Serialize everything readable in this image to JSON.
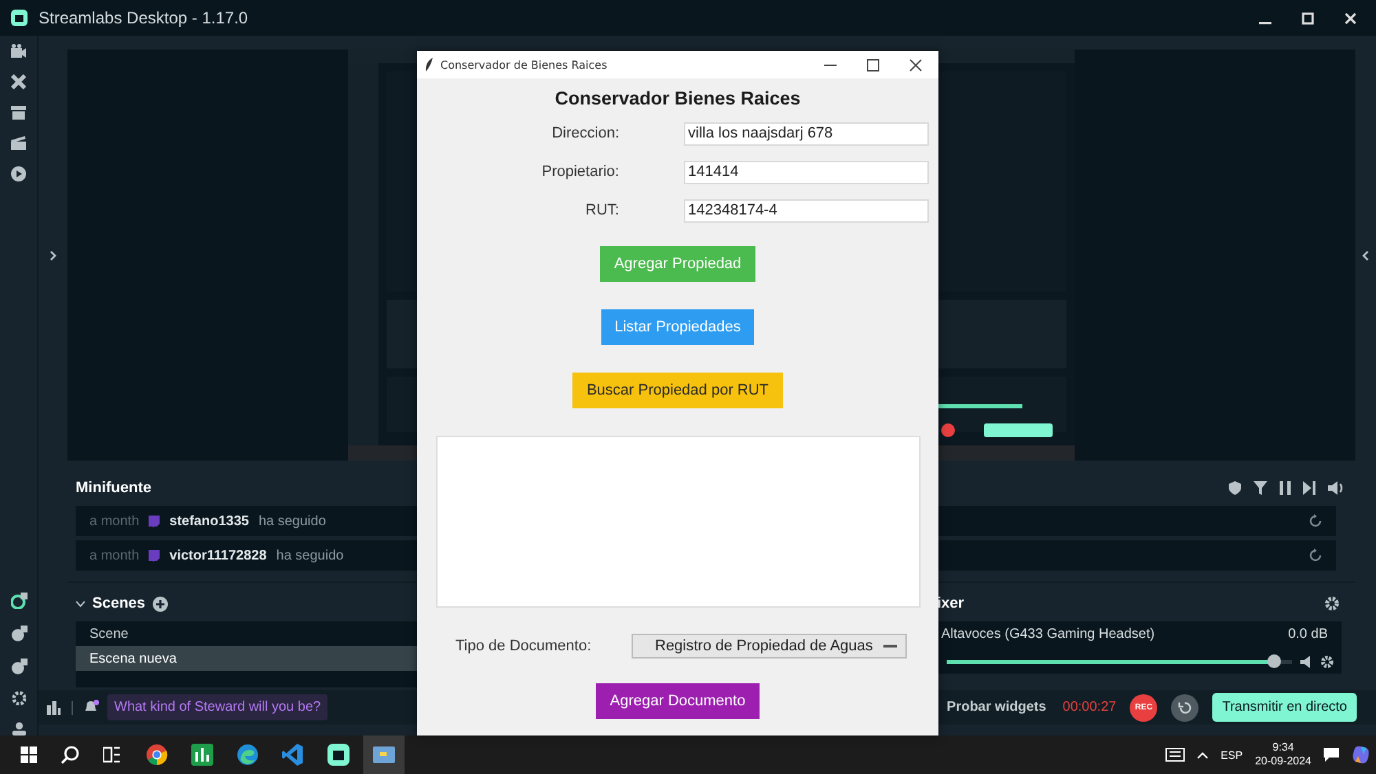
{
  "app": {
    "title": "Streamlabs Desktop - 1.17.0"
  },
  "minifeed": {
    "title": "Minifuente",
    "events": [
      {
        "time": "a month",
        "user": "stefano1335",
        "action": "ha seguido"
      },
      {
        "time": "a month",
        "user": "victor11172828",
        "action": "ha seguido"
      }
    ]
  },
  "scenes": {
    "title": "Scenes",
    "items": [
      {
        "name": "Scene",
        "selected": false
      },
      {
        "name": "Escena nueva",
        "selected": true
      }
    ]
  },
  "mixer": {
    "title": "ixer",
    "sources": [
      {
        "name": "Altavoces (G433 Gaming Headset)",
        "reading": "0.0 dB",
        "level": 0.95
      }
    ]
  },
  "footer": {
    "prompt": "What kind of Steward will you be?",
    "test_widgets": "Probar widgets",
    "timer": "00:00:27",
    "rec": "REC",
    "go_live": "Transmitir en directo"
  },
  "dialog": {
    "title": "Conservador de Bienes Raices",
    "heading": "Conservador Bienes Raices",
    "fields": [
      {
        "label": "Direccion:",
        "value": "villa los naajsdarj 678"
      },
      {
        "label": "Propietario:",
        "value": "141414"
      },
      {
        "label": "RUT:",
        "value": "142348174-4"
      }
    ],
    "buttons": [
      {
        "label": "Agregar Propiedad",
        "color": "#4cbb4f"
      },
      {
        "label": "Listar Propiedades",
        "color": "#2e9cf0"
      },
      {
        "label": "Buscar Propiedad por RUT",
        "color": "#f7c20e"
      }
    ],
    "doc_type": {
      "label": "Tipo de Documento:",
      "value": "Registro de Propiedad de Aguas"
    },
    "submit": {
      "label": "Agregar Documento",
      "color": "#9c1fb0"
    }
  },
  "taskbar": {
    "apps": [
      {
        "kind": "chrome",
        "selected": false
      },
      {
        "kind": "sheets",
        "selected": false
      },
      {
        "kind": "edge",
        "selected": false
      },
      {
        "kind": "code",
        "selected": false
      },
      {
        "kind": "streamlabs",
        "selected": false
      },
      {
        "kind": "python",
        "selected": true
      }
    ],
    "language": "ESP",
    "time": "9:34",
    "date": "20-09-2024"
  }
}
